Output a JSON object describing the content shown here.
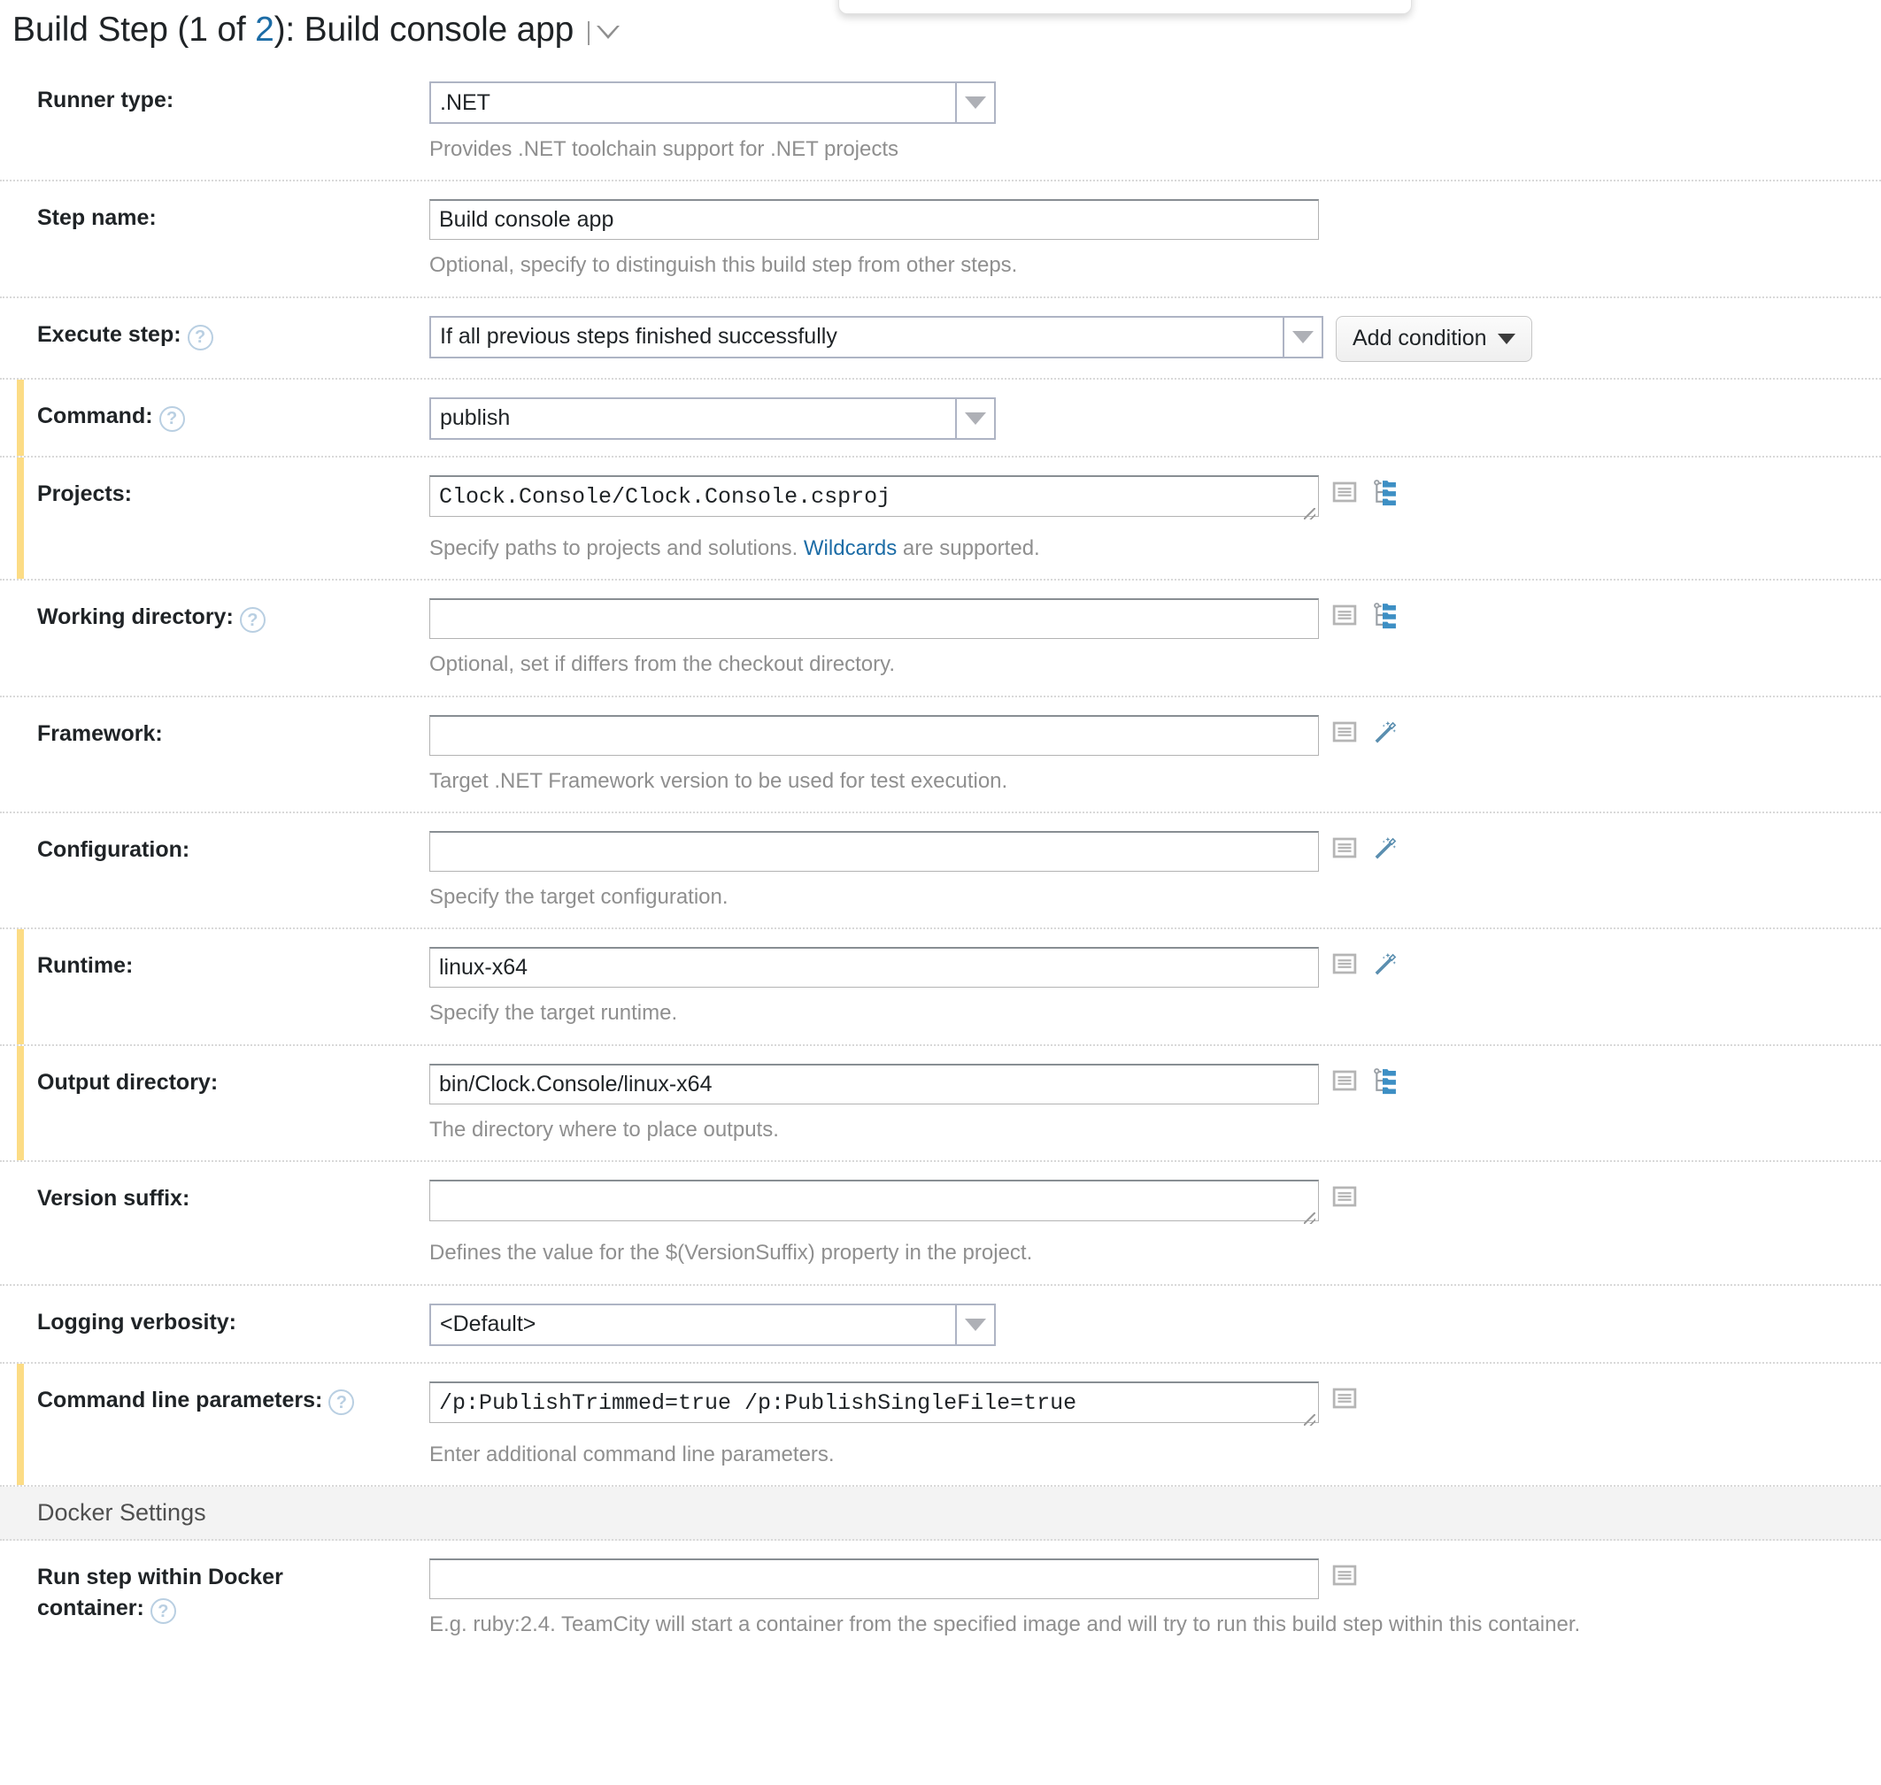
{
  "title": {
    "prefix": "Build Step (1 of ",
    "count": "2",
    "suffix": "): Build console app",
    "menu_icon": "chevron-down-icon"
  },
  "fields": [
    {
      "label": "Runner type:",
      "help": false,
      "control": "select",
      "value": ".NET",
      "hint": "Provides .NET toolchain support for .NET projects",
      "modified": false
    },
    {
      "label": "Step name:",
      "help": false,
      "control": "text",
      "value": "Build console app",
      "hint": "Optional, specify to distinguish this build step from other steps.",
      "modified": false
    },
    {
      "label": "Execute step:",
      "help": true,
      "control": "select",
      "value": "If all previous steps finished successfully",
      "button": "Add condition",
      "hint": "",
      "modified": false
    },
    {
      "label": "Command:",
      "help": true,
      "control": "select",
      "value": "publish",
      "hint": "",
      "modified": true
    },
    {
      "label": "Projects:",
      "help": false,
      "control": "textarea",
      "value": "Clock.Console/Clock.Console.csproj",
      "hint_pre": "Specify paths to projects and solutions. ",
      "hint_link": "Wildcards",
      "hint_post": " are supported.",
      "icons": [
        "list-icon",
        "folder-tree-icon"
      ],
      "modified": true
    },
    {
      "label": "Working directory:",
      "help": true,
      "control": "text",
      "value": "",
      "hint": "Optional, set if differs from the checkout directory.",
      "icons": [
        "list-icon",
        "folder-tree-icon"
      ],
      "modified": false
    },
    {
      "label": "Framework:",
      "help": false,
      "control": "text",
      "value": "",
      "hint": "Target .NET Framework version to be used for test execution.",
      "icons": [
        "list-icon",
        "magic-wand-icon"
      ],
      "modified": false
    },
    {
      "label": "Configuration:",
      "help": false,
      "control": "text",
      "value": "",
      "hint": "Specify the target configuration.",
      "icons": [
        "list-icon",
        "magic-wand-icon"
      ],
      "modified": false
    },
    {
      "label": "Runtime:",
      "help": false,
      "control": "text",
      "value": "linux-x64",
      "hint": "Specify the target runtime.",
      "icons": [
        "list-icon",
        "magic-wand-icon"
      ],
      "modified": true
    },
    {
      "label": "Output directory:",
      "help": false,
      "control": "text",
      "value": "bin/Clock.Console/linux-x64",
      "hint": "The directory where to place outputs.",
      "icons": [
        "list-icon",
        "folder-tree-icon"
      ],
      "modified": true
    },
    {
      "label": "Version suffix:",
      "help": false,
      "control": "textarea",
      "value": "",
      "hint": "Defines the value for the $(VersionSuffix) property in the project.",
      "icons": [
        "list-icon"
      ],
      "modified": false
    },
    {
      "label": "Logging verbosity:",
      "help": false,
      "control": "select",
      "value": "<Default>",
      "hint": "",
      "modified": false
    },
    {
      "label": "Command line parameters:",
      "help": true,
      "control": "textarea",
      "value": "/p:PublishTrimmed=true /p:PublishSingleFile=true",
      "hint": "Enter additional command line parameters.",
      "icons": [
        "list-icon"
      ],
      "modified": true
    }
  ],
  "docker_section": {
    "header": "Docker Settings",
    "field": {
      "label_line1": "Run step within Docker",
      "label_line2": "container:",
      "help": true,
      "value": "",
      "hint": "E.g. ruby:2.4. TeamCity will start a container from the specified image and will try to run this build step within this container.",
      "icons": [
        "list-icon"
      ]
    }
  },
  "colors": {
    "modified_marker": "#fcdc85",
    "link": "#1c6ca6",
    "hint_text": "#8f8f8f",
    "folder_icon": "#3d8fc4",
    "help_icon": "#b9cfe2",
    "section_bg": "#f3f3f3"
  }
}
